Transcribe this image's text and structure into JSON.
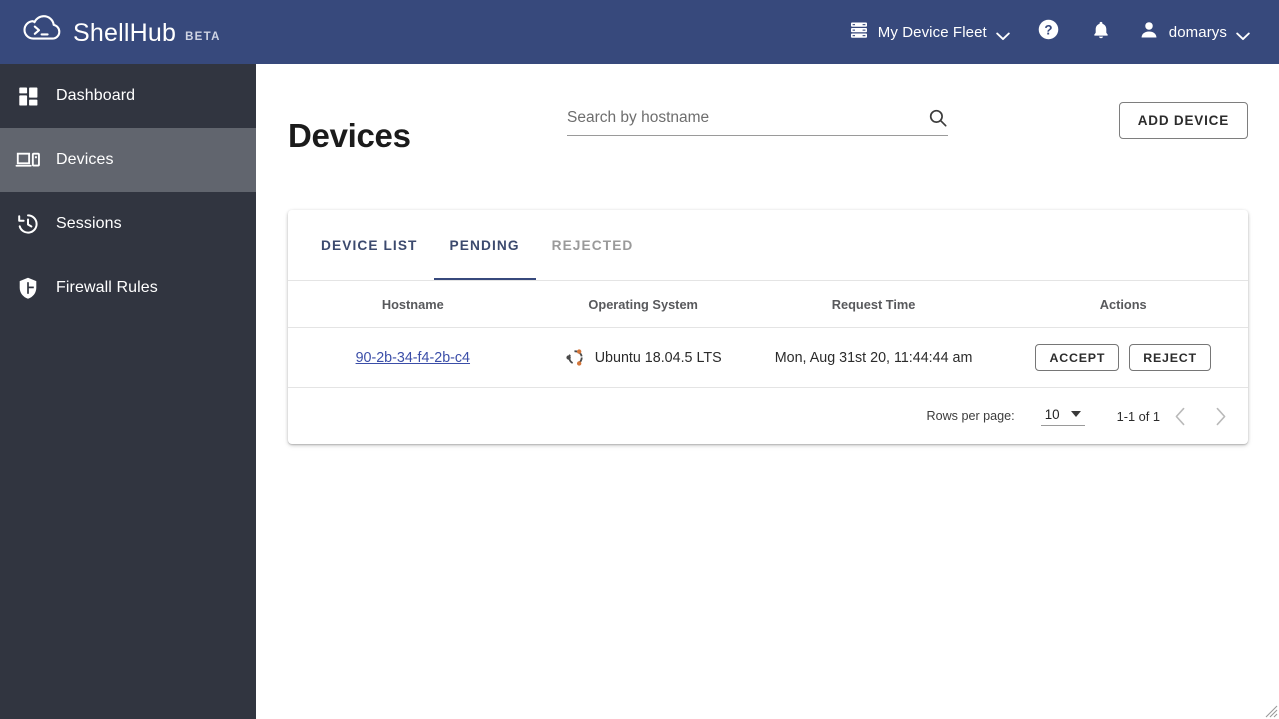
{
  "topbar": {
    "brand_name": "ShellHub",
    "brand_tag": "BETA",
    "logo_icon": "cloud-terminal-icon",
    "namespace": {
      "icon": "server-rack-icon",
      "label": "My Device Fleet",
      "chevron": "chevron-down-icon"
    },
    "help": {
      "icon": "help-circle-icon"
    },
    "notifications": {
      "icon": "bell-icon"
    },
    "user": {
      "icon": "person-icon",
      "label": "domarys",
      "chevron": "chevron-down-icon"
    }
  },
  "sidebar": {
    "items": [
      {
        "label": "Dashboard",
        "icon": "dashboard-grid-icon",
        "active": false
      },
      {
        "label": "Devices",
        "icon": "devices-icon",
        "active": true
      },
      {
        "label": "Sessions",
        "icon": "history-clock-icon",
        "active": false
      },
      {
        "label": "Firewall Rules",
        "icon": "shield-icon",
        "active": false
      }
    ]
  },
  "page": {
    "title": "Devices",
    "search": {
      "placeholder": "Search by hostname",
      "value": "",
      "icon": "search-icon"
    },
    "add_device_label": "ADD DEVICE"
  },
  "tabs": [
    {
      "label": "DEVICE LIST",
      "active": false
    },
    {
      "label": "PENDING",
      "active": true
    },
    {
      "label": "REJECTED",
      "active": false
    }
  ],
  "table": {
    "columns": [
      "Hostname",
      "Operating System",
      "Request Time",
      "Actions"
    ],
    "rows": [
      {
        "hostname": "90-2b-34-f4-2b-c4",
        "os_icon": "ubuntu-icon",
        "os": "Ubuntu 18.04.5 LTS",
        "request_time": "Mon, Aug 31st 20, 11:44:44 am",
        "accept_label": "ACCEPT",
        "reject_label": "REJECT"
      }
    ]
  },
  "pagination": {
    "rows_per_page_label": "Rows per page:",
    "rows_per_page_value": "10",
    "dropdown_icon": "triangle-down-icon",
    "range_label": "1-1 of 1",
    "prev_icon": "chevron-left-icon",
    "next_icon": "chevron-right-icon"
  },
  "colors": {
    "topbar": "#37497c",
    "sidebar": "#313540",
    "sidebar_active": "#61656e",
    "accent": "#37497c",
    "link": "#3b4ea8"
  }
}
